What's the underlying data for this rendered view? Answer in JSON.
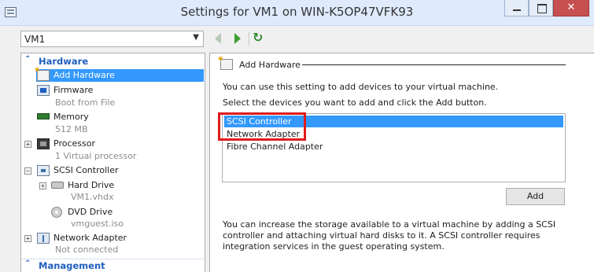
{
  "window": {
    "title": "Settings for VM1 on WIN-K5OP47VFK93"
  },
  "vm_selector": {
    "value": "VM1"
  },
  "tree": {
    "hardware_section": "Hardware",
    "management_section": "Management",
    "items": [
      {
        "label": "Add Hardware",
        "sub": ""
      },
      {
        "label": "Firmware",
        "sub": "Boot from File"
      },
      {
        "label": "Memory",
        "sub": "512 MB"
      },
      {
        "label": "Processor",
        "sub": "1 Virtual processor"
      },
      {
        "label": "SCSI Controller",
        "sub": ""
      },
      {
        "label": "Hard Drive",
        "sub": "VM1.vhdx"
      },
      {
        "label": "DVD Drive",
        "sub": "vmguest.iso"
      },
      {
        "label": "Network Adapter",
        "sub": "Not connected"
      }
    ]
  },
  "details": {
    "group_title": "Add Hardware",
    "description_1": "You can use this setting to add devices to your virtual machine.",
    "description_2": "Select the devices you want to add and click the Add button.",
    "devices": [
      "SCSI Controller",
      "Network Adapter",
      "Fibre Channel Adapter"
    ],
    "selected_device": "SCSI Controller",
    "add_button": "Add",
    "info_text": "You can increase the storage available to a virtual machine by adding a SCSI controller and attaching virtual hard disks to it. A SCSI controller requires integration services in the guest operating system."
  },
  "colors": {
    "selection": "#3399ff",
    "section_heading": "#1f5fbf",
    "highlight_box": "#e01b1b"
  }
}
